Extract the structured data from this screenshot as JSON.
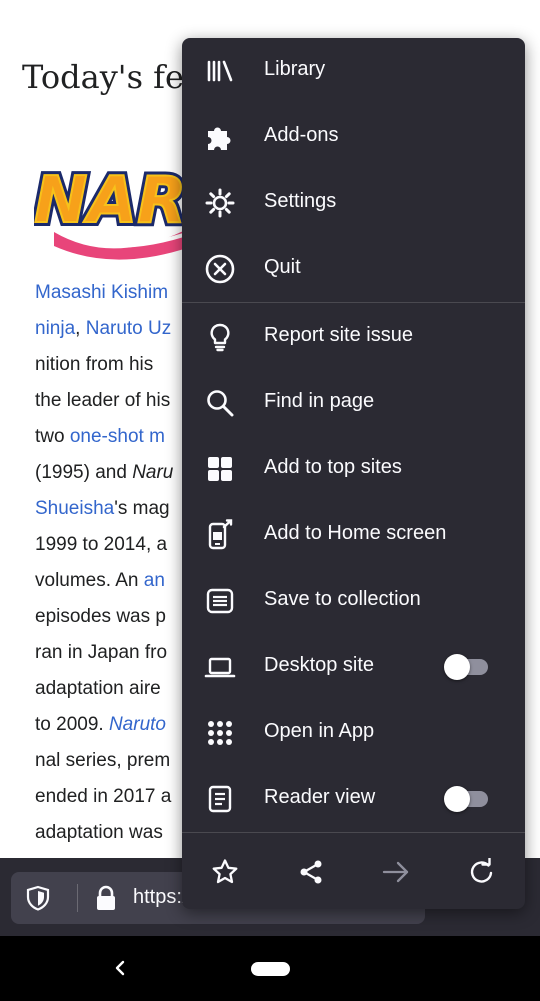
{
  "article": {
    "title": "Today's fea",
    "lines": [
      {
        "parts": [
          {
            "t": "Masashi Kishim",
            "k": "link"
          }
        ]
      },
      {
        "parts": [
          {
            "t": "ninja",
            "k": "link"
          },
          {
            "t": ", ",
            "k": ""
          },
          {
            "t": "Naruto Uz",
            "k": "link"
          }
        ]
      },
      {
        "parts": [
          {
            "t": "nition from his",
            "k": ""
          }
        ]
      },
      {
        "parts": [
          {
            "t": "the leader of his",
            "k": ""
          }
        ]
      },
      {
        "parts": [
          {
            "t": "two ",
            "k": ""
          },
          {
            "t": "one-shot m",
            "k": "link"
          }
        ]
      },
      {
        "parts": [
          {
            "t": "(1995) and ",
            "k": ""
          },
          {
            "t": "Naru",
            "k": "ital"
          }
        ]
      },
      {
        "parts": [
          {
            "t": "Shueisha",
            "k": "link"
          },
          {
            "t": "'s mag",
            "k": ""
          }
        ]
      },
      {
        "parts": [
          {
            "t": "1999 to 2014, a",
            "k": ""
          }
        ]
      },
      {
        "parts": [
          {
            "t": "volumes. An ",
            "k": ""
          },
          {
            "t": "an",
            "k": "link"
          }
        ]
      },
      {
        "parts": [
          {
            "t": "episodes was p",
            "k": ""
          }
        ]
      },
      {
        "parts": [
          {
            "t": "ran in Japan fro",
            "k": ""
          }
        ]
      },
      {
        "parts": [
          {
            "t": "adaptation aire",
            "k": ""
          }
        ]
      },
      {
        "parts": [
          {
            "t": "to 2009. ",
            "k": ""
          },
          {
            "t": "Naruto",
            "k": "link ital"
          }
        ]
      },
      {
        "parts": [
          {
            "t": "nal series, prem",
            "k": ""
          }
        ]
      },
      {
        "parts": [
          {
            "t": "ended in 2017 a",
            "k": ""
          }
        ]
      },
      {
        "parts": [
          {
            "t": "adaptation was",
            "k": ""
          }
        ]
      }
    ]
  },
  "toolbar": {
    "url": "https:/"
  },
  "menu": {
    "items": [
      {
        "label": "Library",
        "icon": "library-icon"
      },
      {
        "label": "Add-ons",
        "icon": "puzzle-icon"
      },
      {
        "label": "Settings",
        "icon": "gear-icon"
      },
      {
        "label": "Quit",
        "icon": "close-circle-icon"
      },
      {
        "label": "Report site issue",
        "icon": "lightbulb-icon"
      },
      {
        "label": "Find in page",
        "icon": "search-icon"
      },
      {
        "label": "Add to top sites",
        "icon": "grid-icon"
      },
      {
        "label": "Add to Home screen",
        "icon": "add-to-phone-icon"
      },
      {
        "label": "Save to collection",
        "icon": "collection-icon"
      },
      {
        "label": "Desktop site",
        "icon": "laptop-icon",
        "toggle": false
      },
      {
        "label": "Open in App",
        "icon": "apps-icon"
      },
      {
        "label": "Reader view",
        "icon": "reader-icon",
        "toggle": false
      }
    ],
    "bottom": [
      "star-icon",
      "share-icon",
      "forward-arrow-icon",
      "reload-icon"
    ]
  },
  "colors": {
    "menu_bg": "#2b2a33",
    "menu_text": "#fbfbfe",
    "link": "#3366cc",
    "disabled_icon": "#8f8f9d"
  }
}
